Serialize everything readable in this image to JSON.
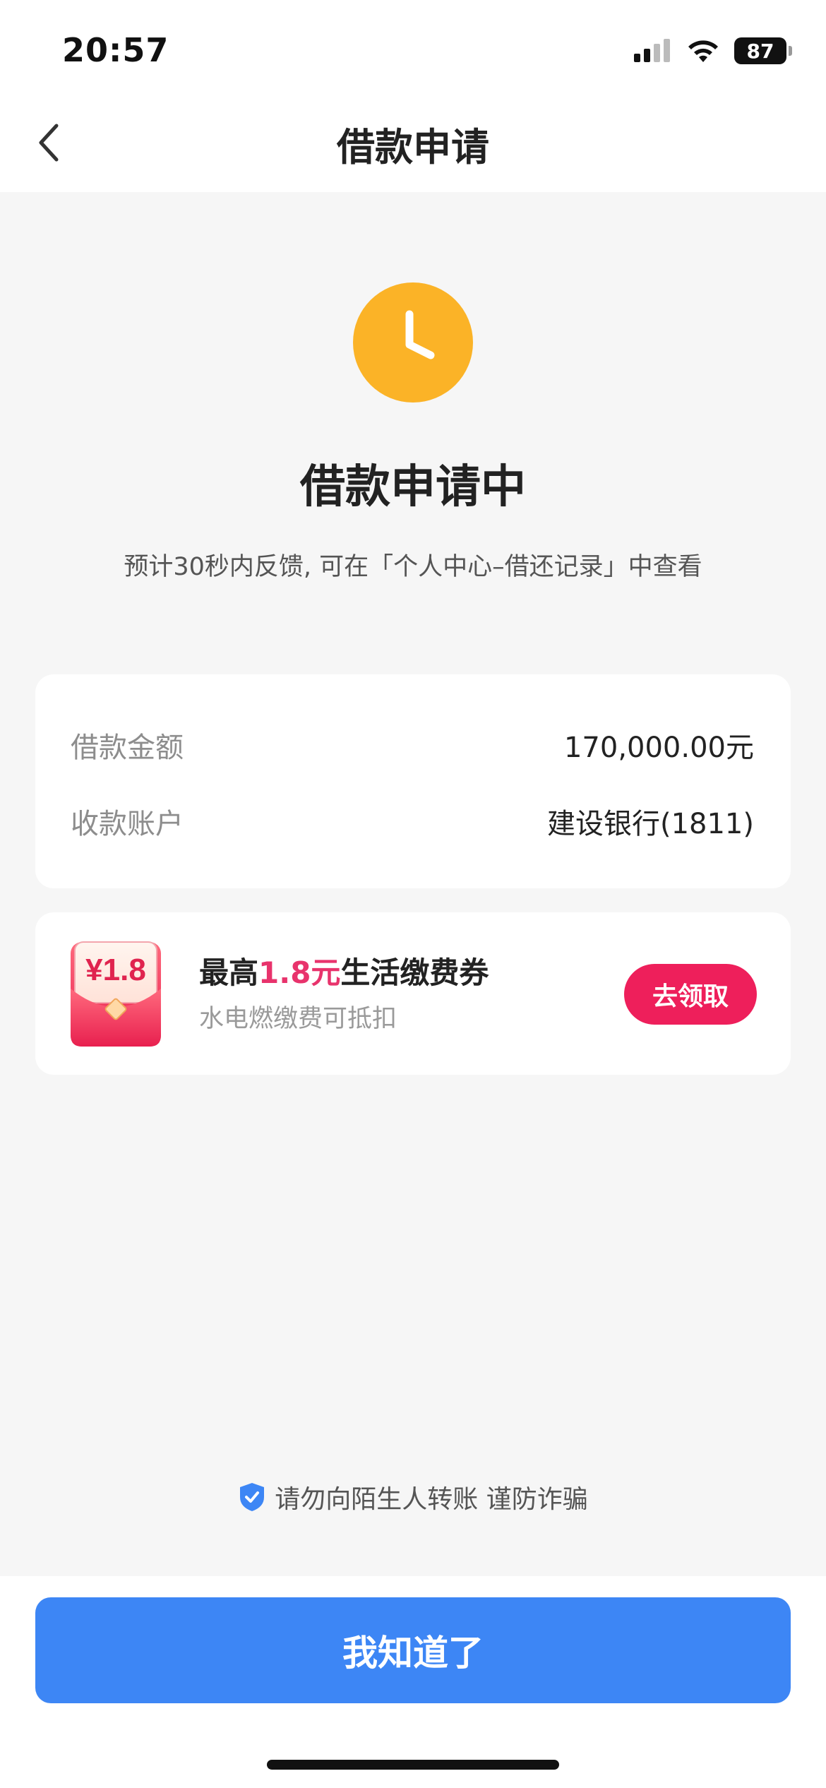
{
  "status_bar": {
    "time": "20:57",
    "battery": "87"
  },
  "nav": {
    "title": "借款申请",
    "back_icon": "chevron-left-icon"
  },
  "status": {
    "icon": "clock-icon",
    "icon_color": "#fbb327",
    "title": "借款申请中",
    "description": "预计30秒内反馈, 可在「个人中心–借还记录」中查看"
  },
  "info": {
    "rows": [
      {
        "label": "借款金额",
        "value": "170,000.00元"
      },
      {
        "label": "收款账户",
        "value": "建设银行(1811)"
      }
    ]
  },
  "coupon": {
    "badge_amount": "¥1.8",
    "title_prefix": "最高",
    "title_amount": "1.8元",
    "title_suffix": "生活缴费券",
    "subtitle": "水电燃缴费可抵扣",
    "button_label": "去领取",
    "accent_color": "#ee1f5b"
  },
  "notice": {
    "icon": "shield-check-icon",
    "text": "请勿向陌生人转账 谨防诈骗"
  },
  "footer": {
    "confirm_label": "我知道了",
    "button_color": "#3d86f5"
  }
}
